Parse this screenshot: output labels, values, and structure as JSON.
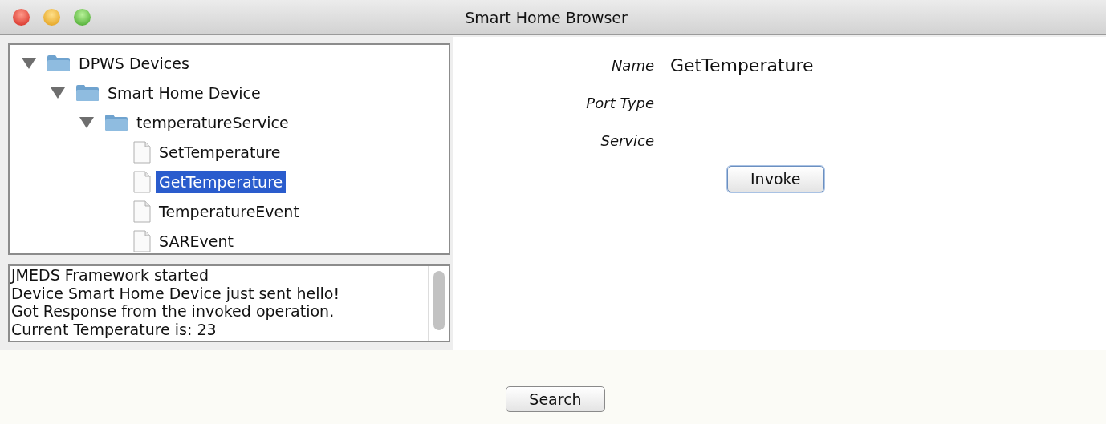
{
  "window": {
    "title": "Smart Home Browser"
  },
  "tree": [
    {
      "label": "DPWS Devices",
      "kind": "folder",
      "expanded": true,
      "selected": false,
      "children": [
        {
          "label": "Smart Home Device",
          "kind": "folder",
          "expanded": true,
          "selected": false,
          "children": [
            {
              "label": "temperatureService",
              "kind": "folder",
              "expanded": true,
              "selected": false,
              "children": [
                {
                  "label": "SetTemperature",
                  "kind": "file",
                  "selected": false
                },
                {
                  "label": "GetTemperature",
                  "kind": "file",
                  "selected": true
                },
                {
                  "label": "TemperatureEvent",
                  "kind": "file",
                  "selected": false
                },
                {
                  "label": "SAREvent",
                  "kind": "file",
                  "selected": false
                }
              ]
            }
          ]
        }
      ]
    }
  ],
  "log": [
    "JMEDS Framework started",
    "Device Smart Home Device just sent hello!",
    "Got Response from the invoked operation.",
    "Current Temperature is: 23"
  ],
  "details": [
    {
      "label": "Name",
      "value": "GetTemperature"
    },
    {
      "label": "Port Type"
    },
    {
      "label": "Service"
    }
  ],
  "invoke_button": "Invoke",
  "search_button": "Search"
}
